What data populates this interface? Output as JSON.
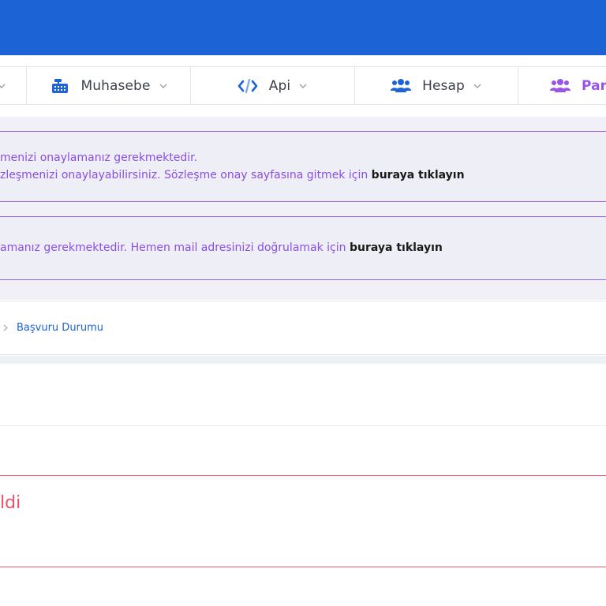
{
  "nav": {
    "items": [
      {
        "label": "Muhasebe",
        "icon": "cash-register-icon"
      },
      {
        "label": "Api",
        "icon": "code-icon"
      },
      {
        "label": "Hesap",
        "icon": "users-icon"
      },
      {
        "label": "Par",
        "icon": "users-icon"
      }
    ]
  },
  "alerts": [
    {
      "line1": "menizi onaylamanız gerekmektedir.",
      "line2_text": "zleşmenizi onaylayabilirsiniz. Sözleşme onay sayfasına gitmek için ",
      "line2_link": "buraya tıklayın"
    },
    {
      "line1_text": "amanız gerekmektedir. Hemen mail adresinizi doğrulamak için ",
      "line1_link": "buraya tıklayın"
    }
  ],
  "breadcrumb": {
    "current": "Başvuru Durumu"
  },
  "error": {
    "text": "ldi"
  },
  "colors": {
    "topbar": "#1c63d6",
    "accent_purple": "#8a4fe0",
    "error_red": "#f0506a",
    "link_blue": "#1c63d6"
  }
}
